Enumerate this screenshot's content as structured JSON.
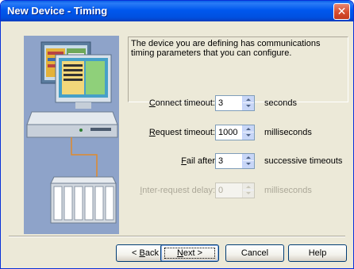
{
  "window": {
    "title": "New Device - Timing",
    "close_glyph": "✕"
  },
  "description": "The device you are defining has communications timing parameters that you can configure.",
  "fields": {
    "connect_timeout": {
      "label_hot": "C",
      "label_rest": "onnect timeout:",
      "value": "3",
      "unit": "seconds"
    },
    "request_timeout": {
      "label_hot": "R",
      "label_rest": "equest timeout:",
      "value": "1000",
      "unit": "milliseconds"
    },
    "fail_after": {
      "label_hot": "F",
      "label_rest": "ail after",
      "value": "3",
      "unit": "successive timeouts"
    },
    "inter_request_delay": {
      "label_hot": "I",
      "label_rest": "nter-request delay:",
      "value": "0",
      "unit": "milliseconds",
      "enabled": false
    }
  },
  "buttons": {
    "back": {
      "prefix": "< ",
      "hot": "B",
      "rest": "ack"
    },
    "next": {
      "hot": "N",
      "rest": "ext >"
    },
    "cancel": "Cancel",
    "help": "Help"
  },
  "colors": {
    "title_bar": "#0058ee",
    "dialog_bg": "#ece9d8",
    "close_button": "#d64d2f"
  }
}
